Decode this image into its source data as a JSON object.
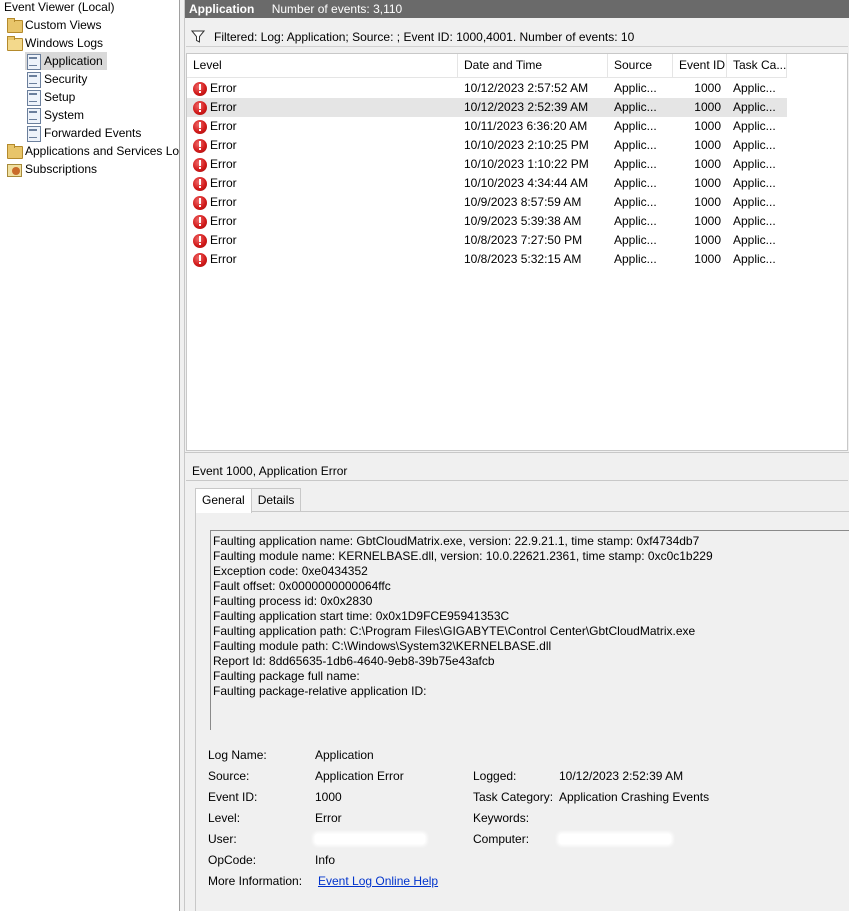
{
  "tree": {
    "items": [
      {
        "label": "Event Viewer (Local)"
      },
      {
        "label": "Custom Views"
      },
      {
        "label": "Windows Logs"
      },
      {
        "label": "Application"
      },
      {
        "label": "Security"
      },
      {
        "label": "Setup"
      },
      {
        "label": "System"
      },
      {
        "label": "Forwarded Events"
      },
      {
        "label": "Applications and Services Lo"
      },
      {
        "label": "Subscriptions"
      }
    ]
  },
  "header": {
    "title": "Application",
    "event_count": "Number of events: 3,110"
  },
  "filter": {
    "text": "Filtered: Log: Application; Source: ; Event ID: 1000,4001. Number of events: 10"
  },
  "grid": {
    "columns": {
      "level": "Level",
      "date": "Date and Time",
      "source": "Source",
      "event_id": "Event ID",
      "task": "Task Ca..."
    },
    "rows": [
      {
        "level": "Error",
        "date": "10/12/2023 2:57:52 AM",
        "source": "Applic...",
        "event_id": "1000",
        "task": "Applic..."
      },
      {
        "level": "Error",
        "date": "10/12/2023 2:52:39 AM",
        "source": "Applic...",
        "event_id": "1000",
        "task": "Applic..."
      },
      {
        "level": "Error",
        "date": "10/11/2023 6:36:20 AM",
        "source": "Applic...",
        "event_id": "1000",
        "task": "Applic..."
      },
      {
        "level": "Error",
        "date": "10/10/2023 2:10:25 PM",
        "source": "Applic...",
        "event_id": "1000",
        "task": "Applic..."
      },
      {
        "level": "Error",
        "date": "10/10/2023 1:10:22 PM",
        "source": "Applic...",
        "event_id": "1000",
        "task": "Applic..."
      },
      {
        "level": "Error",
        "date": "10/10/2023 4:34:44 AM",
        "source": "Applic...",
        "event_id": "1000",
        "task": "Applic..."
      },
      {
        "level": "Error",
        "date": "10/9/2023 8:57:59 AM",
        "source": "Applic...",
        "event_id": "1000",
        "task": "Applic..."
      },
      {
        "level": "Error",
        "date": "10/9/2023 5:39:38 AM",
        "source": "Applic...",
        "event_id": "1000",
        "task": "Applic..."
      },
      {
        "level": "Error",
        "date": "10/8/2023 7:27:50 PM",
        "source": "Applic...",
        "event_id": "1000",
        "task": "Applic..."
      },
      {
        "level": "Error",
        "date": "10/8/2023 5:32:15 AM",
        "source": "Applic...",
        "event_id": "1000",
        "task": "Applic..."
      }
    ]
  },
  "detail": {
    "title": "Event 1000, Application Error",
    "tabs": {
      "general": "General",
      "details": "Details"
    },
    "description": [
      "Faulting application name: GbtCloudMatrix.exe, version: 22.9.21.1, time stamp: 0xf4734db7",
      "Faulting module name: KERNELBASE.dll, version: 10.0.22621.2361, time stamp: 0xc0c1b229",
      "Exception code: 0xe0434352",
      "Fault offset: 0x0000000000064ffc",
      "Faulting process id: 0x0x2830",
      "Faulting application start time: 0x0x1D9FCE95941353C",
      "Faulting application path: C:\\Program Files\\GIGABYTE\\Control Center\\GbtCloudMatrix.exe",
      "Faulting module path: C:\\Windows\\System32\\KERNELBASE.dll",
      "Report Id: 8dd65635-1db6-4640-9eb8-39b75e43afcb",
      "Faulting package full name:",
      "Faulting package-relative application ID:"
    ],
    "props": {
      "log_name_label": "Log Name:",
      "log_name_value": "Application",
      "source_label": "Source:",
      "source_value": "Application Error",
      "logged_label": "Logged:",
      "logged_value": "10/12/2023 2:52:39 AM",
      "event_id_label": "Event ID:",
      "event_id_value": "1000",
      "task_label": "Task Category:",
      "task_value": "Application Crashing Events",
      "level_label": "Level:",
      "level_value": "Error",
      "keywords_label": "Keywords:",
      "user_label": "User:",
      "computer_label": "Computer:",
      "opcode_label": "OpCode:",
      "opcode_value": "Info",
      "more_info_label": "More Information:",
      "more_info_link": "Event Log Online Help"
    }
  }
}
